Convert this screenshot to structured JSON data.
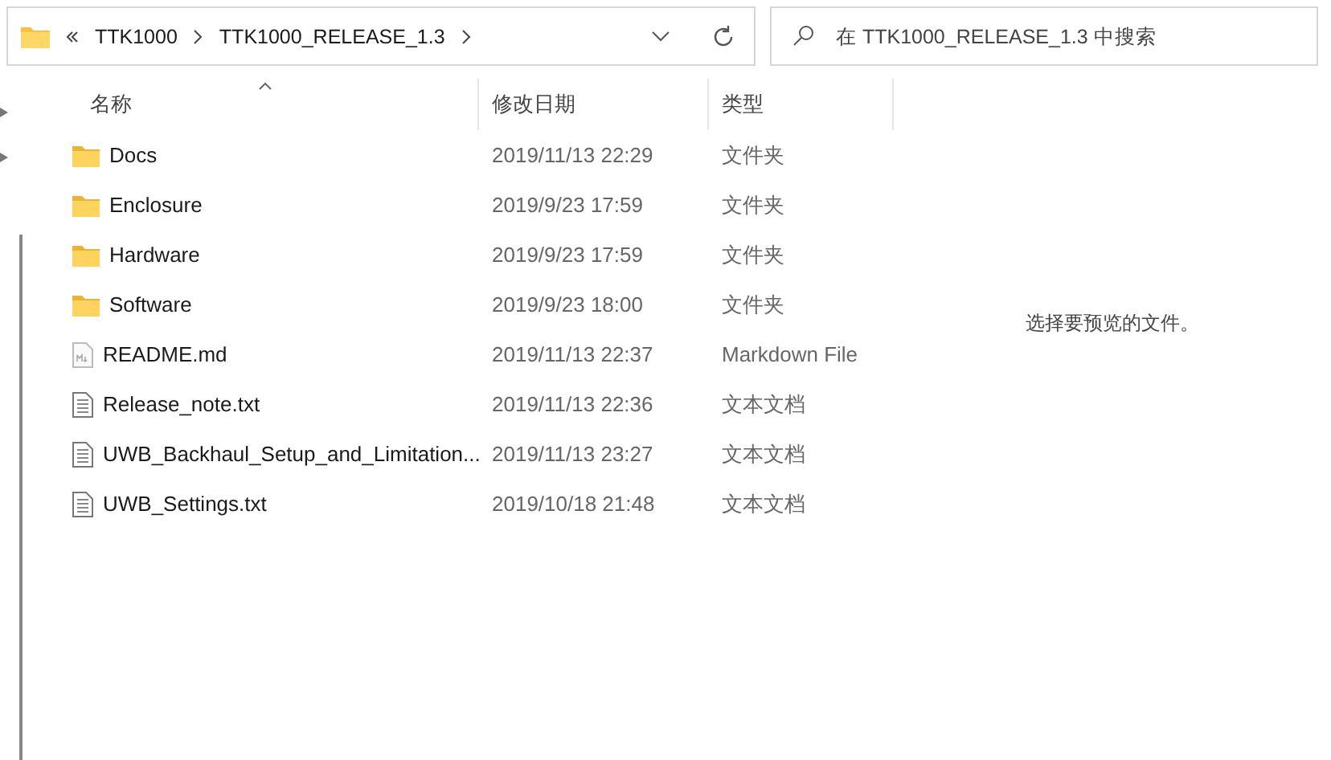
{
  "address_bar": {
    "path": [
      "TTK1000",
      "TTK1000_RELEASE_1.3"
    ]
  },
  "search": {
    "placeholder": "在 TTK1000_RELEASE_1.3 中搜索"
  },
  "table": {
    "columns": [
      {
        "label": "名称",
        "sorted": true
      },
      {
        "label": "修改日期",
        "sorted": false
      },
      {
        "label": "类型",
        "sorted": false
      }
    ],
    "rows": [
      {
        "kind": "folder",
        "name": "Docs",
        "modified": "2019/11/13 22:29",
        "type": "文件夹"
      },
      {
        "kind": "folder",
        "name": "Enclosure",
        "modified": "2019/9/23 17:59",
        "type": "文件夹"
      },
      {
        "kind": "folder",
        "name": "Hardware",
        "modified": "2019/9/23 17:59",
        "type": "文件夹"
      },
      {
        "kind": "folder",
        "name": "Software",
        "modified": "2019/9/23 18:00",
        "type": "文件夹"
      },
      {
        "kind": "markdown",
        "name": "README.md",
        "modified": "2019/11/13 22:37",
        "type": "Markdown File"
      },
      {
        "kind": "text",
        "name": "Release_note.txt",
        "modified": "2019/11/13 22:36",
        "type": "文本文档"
      },
      {
        "kind": "text",
        "name": "UWB_Backhaul_Setup_and_Limitation...",
        "modified": "2019/11/13 23:27",
        "type": "文本文档"
      },
      {
        "kind": "text",
        "name": "UWB_Settings.txt",
        "modified": "2019/10/18 21:48",
        "type": "文本文档"
      }
    ]
  },
  "preview": {
    "message": "选择要预览的文件。"
  }
}
